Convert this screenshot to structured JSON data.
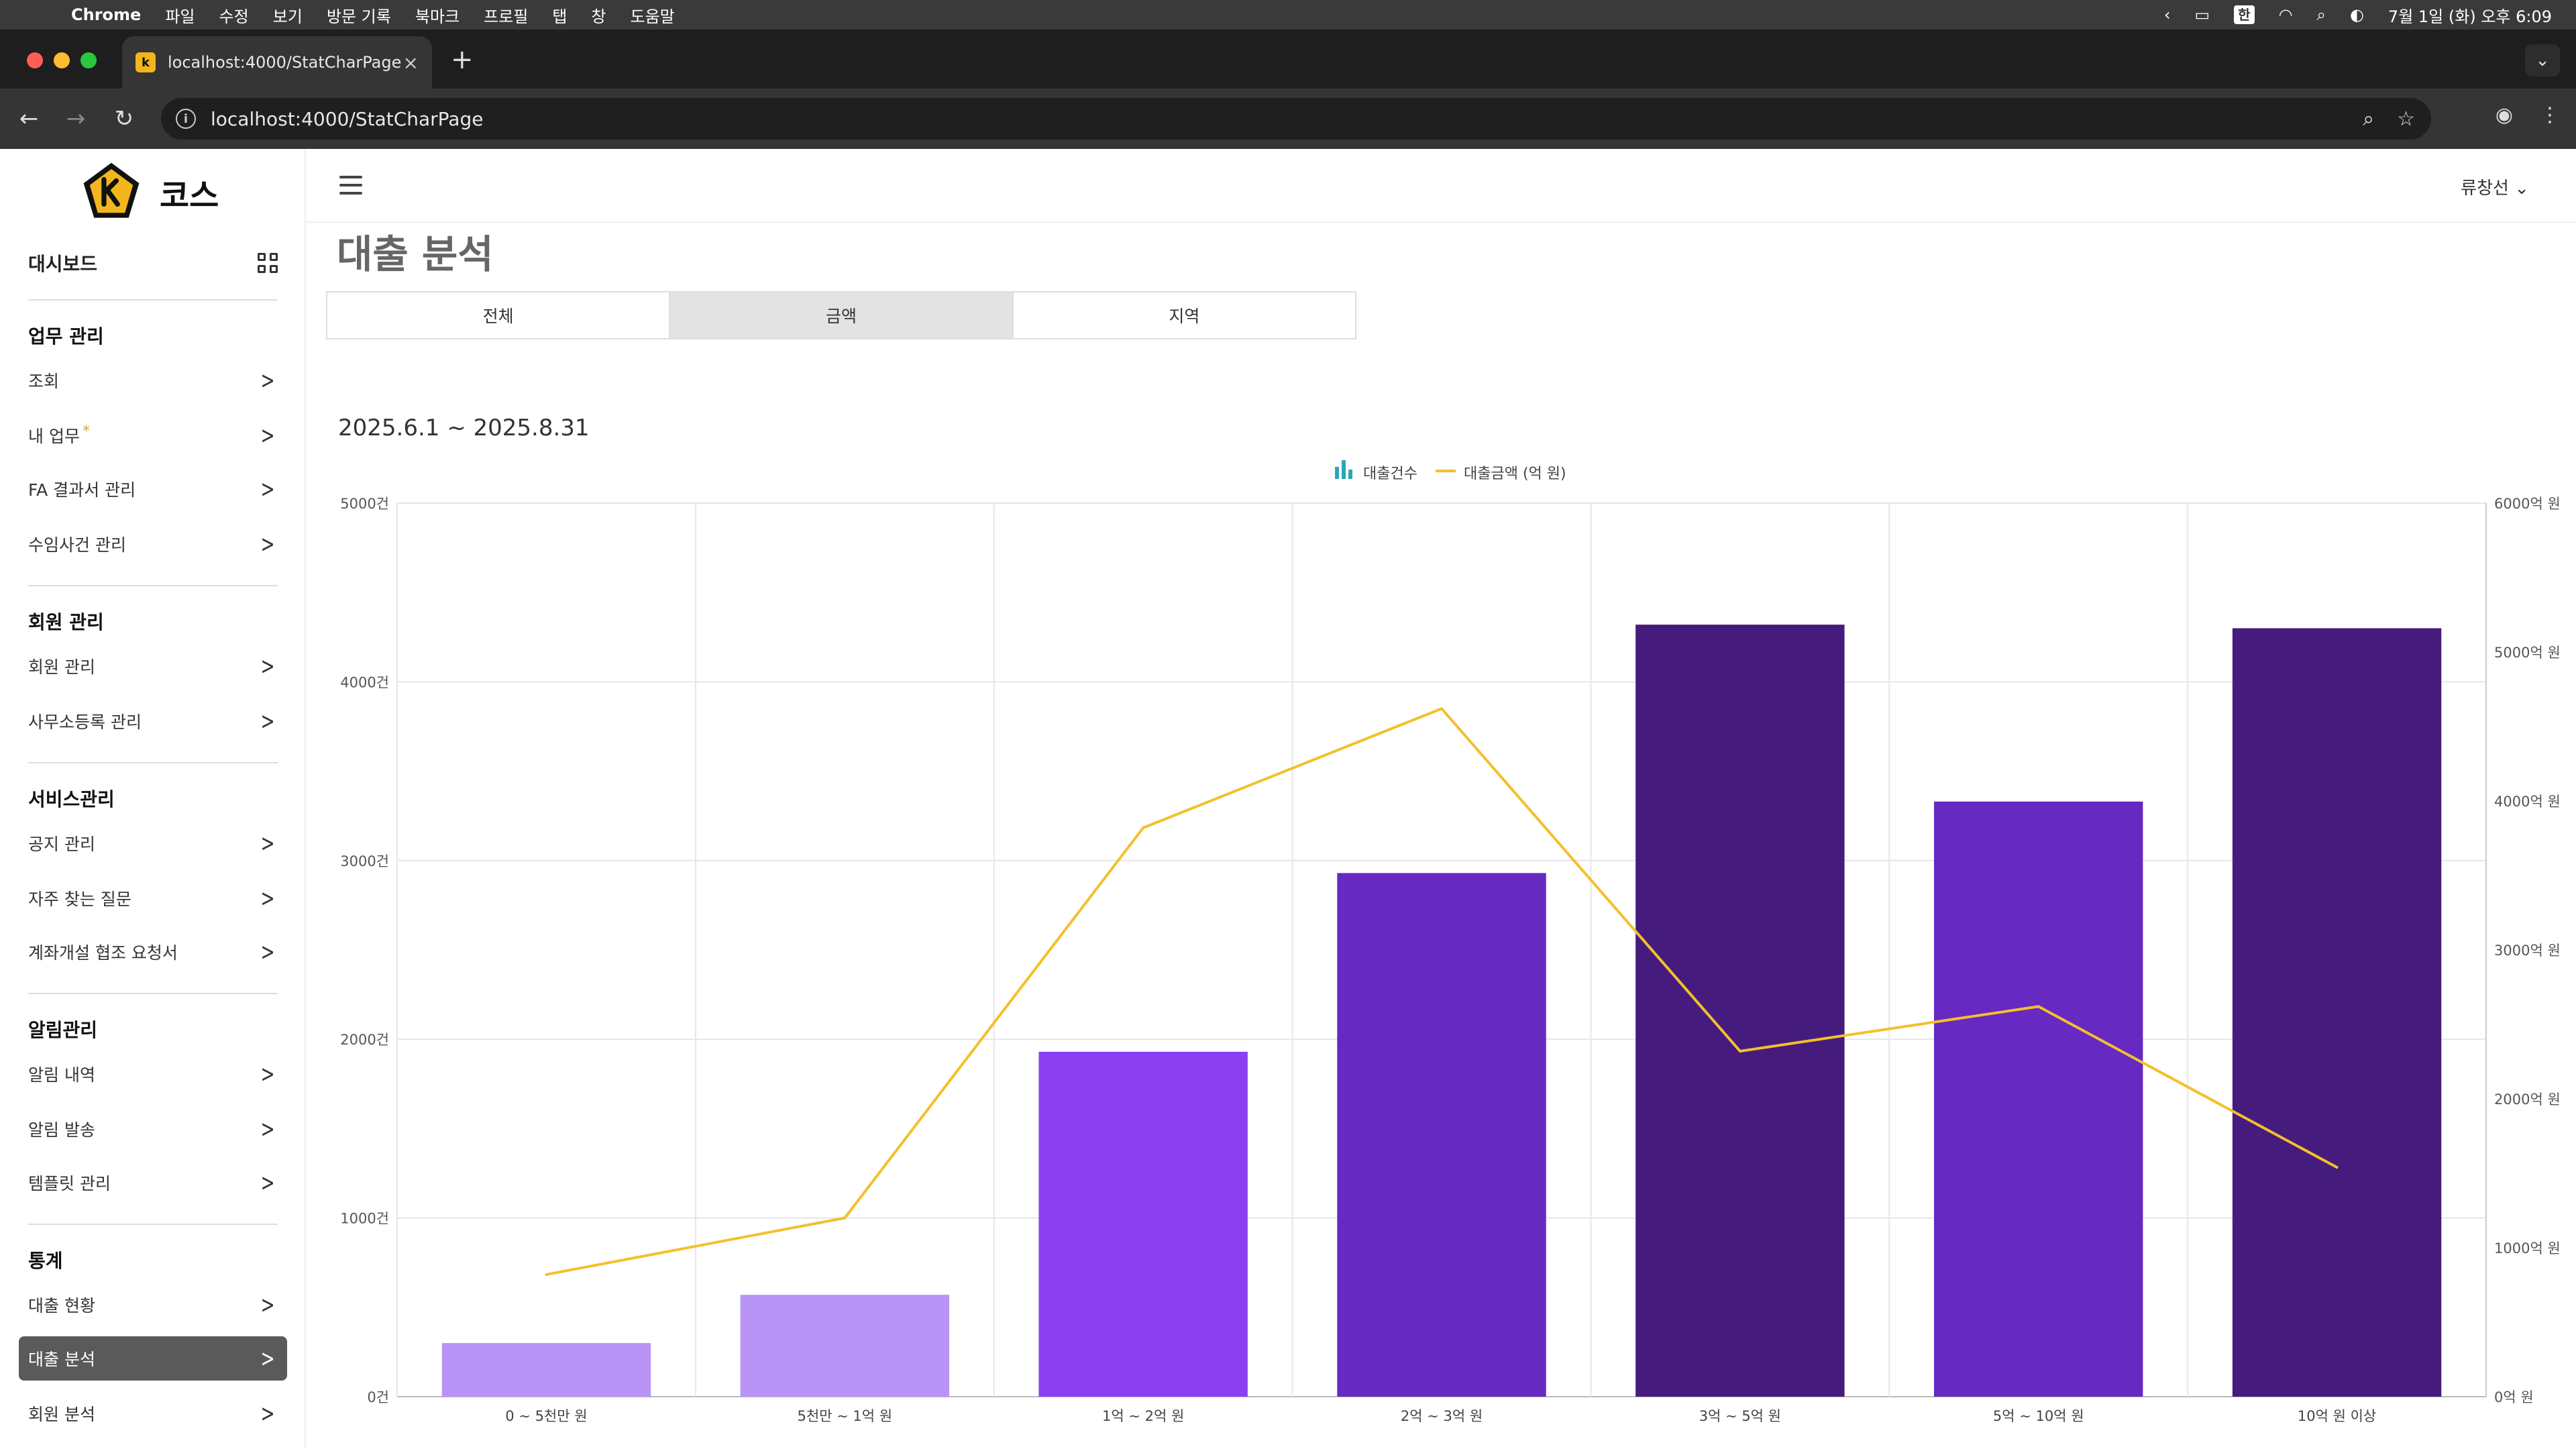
{
  "menubar": {
    "app": "Chrome",
    "menus": [
      "파일",
      "수정",
      "보기",
      "방문 기록",
      "북마크",
      "프로필",
      "탭",
      "창",
      "도움말"
    ],
    "input_mode": "한",
    "clock": "7월 1일 (화) 오후 6:09"
  },
  "browser": {
    "tab_title": "localhost:4000/StatCharPage",
    "url": "localhost:4000/StatCharPage"
  },
  "sidebar": {
    "brand": "코스",
    "dashboard": "대시보드",
    "sections": [
      {
        "title": "업무 관리",
        "items": [
          "조회",
          "내 업무",
          "FA 결과서 관리",
          "수임사건 관리"
        ]
      },
      {
        "title": "회원 관리",
        "items": [
          "회원 관리",
          "사무소등록 관리"
        ]
      },
      {
        "title": "서비스관리",
        "items": [
          "공지 관리",
          "자주 찾는 질문",
          "계좌개설 협조 요청서"
        ]
      },
      {
        "title": "알림관리",
        "items": [
          "알림 내역",
          "알림 발송",
          "템플릿 관리"
        ]
      },
      {
        "title": "통계",
        "items": [
          "대출 현황",
          "대출 분석",
          "회원 분석"
        ]
      }
    ],
    "new_badge": "*",
    "active_item": "대출 분석"
  },
  "header": {
    "user": "류창선"
  },
  "page": {
    "title": "대출 분석",
    "tabs": [
      "전체",
      "금액",
      "지역"
    ],
    "active_tab": "금액",
    "period": "2025.6.1 ~ 2025.8.31"
  },
  "chart_data": {
    "type": "bar+line",
    "categories": [
      "0 ~ 5천만 원",
      "5천만 ~ 1억 원",
      "1억 ~ 2억 원",
      "2억 ~ 3억 원",
      "3억 ~ 5억 원",
      "5억 ~ 10억 원",
      "10억 원 이상"
    ],
    "series": [
      {
        "name": "대출건수",
        "type": "bar",
        "axis": "left",
        "values": [
          300,
          570,
          1930,
          2930,
          4320,
          3330,
          4300
        ]
      },
      {
        "name": "대출금액 (억 원)",
        "type": "line",
        "axis": "right",
        "values": [
          820,
          1200,
          3820,
          4620,
          2320,
          2620,
          1540
        ]
      }
    ],
    "bar_colors": [
      "#b794f6",
      "#b794f6",
      "#8a3ff0",
      "#6629c1",
      "#451c7d",
      "#6629c1",
      "#451c7d"
    ],
    "line_color": "#f3c02c",
    "legend_icon_color": "#2aa6b5",
    "y_left": {
      "min": 0,
      "max": 5000,
      "ticks": [
        0,
        1000,
        2000,
        3000,
        4000,
        5000
      ],
      "labels": [
        "0건",
        "1000건",
        "2000건",
        "3000건",
        "4000건",
        "5000건"
      ]
    },
    "y_right": {
      "min": 0,
      "max": 6000,
      "ticks": [
        0,
        1000,
        2000,
        3000,
        4000,
        5000,
        6000
      ],
      "labels": [
        "0억 원",
        "1000억 원",
        "2000억 원",
        "3000억 원",
        "4000억 원",
        "5000억 원",
        "6000억 원"
      ]
    },
    "legend_position": "top-center",
    "grid": true
  }
}
